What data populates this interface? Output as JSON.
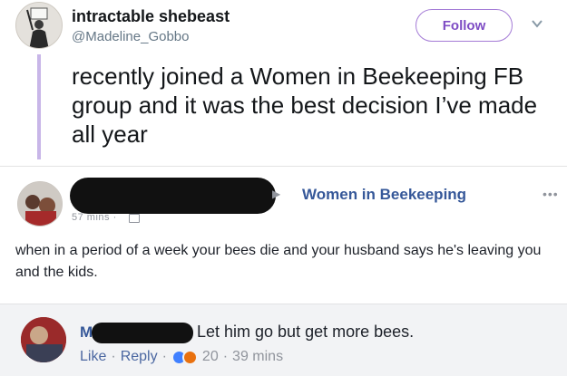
{
  "tweet": {
    "display_name": "intractable shebeast",
    "handle": "@Madeline_Gobbo",
    "follow_label": "Follow",
    "text": "recently joined a Women in Beekeeping FB group and it was the best decision I’ve made all year",
    "colors": {
      "follow_border": "#a47bd6",
      "thread_line": "#c8b6e8"
    },
    "icons": {
      "menu": "chevron-down-icon"
    }
  },
  "fb_post": {
    "group_name": "Women in Beekeeping",
    "time_partial": "57 mins · ",
    "text": "when in a period of a week your bees die and your husband says he's leaving you and the kids.",
    "icons": {
      "arrow": "triangle-right-icon",
      "privacy": "group-icon",
      "more": "more-dots-icon"
    }
  },
  "comment": {
    "name_initial": "M",
    "text": "Let him go but get more bees.",
    "actions": {
      "like": "Like",
      "reply": "Reply",
      "reaction_count": "20",
      "time": "39 mins"
    },
    "icons": {
      "reactions": [
        "like-reaction-icon",
        "angry-reaction-icon"
      ]
    }
  }
}
